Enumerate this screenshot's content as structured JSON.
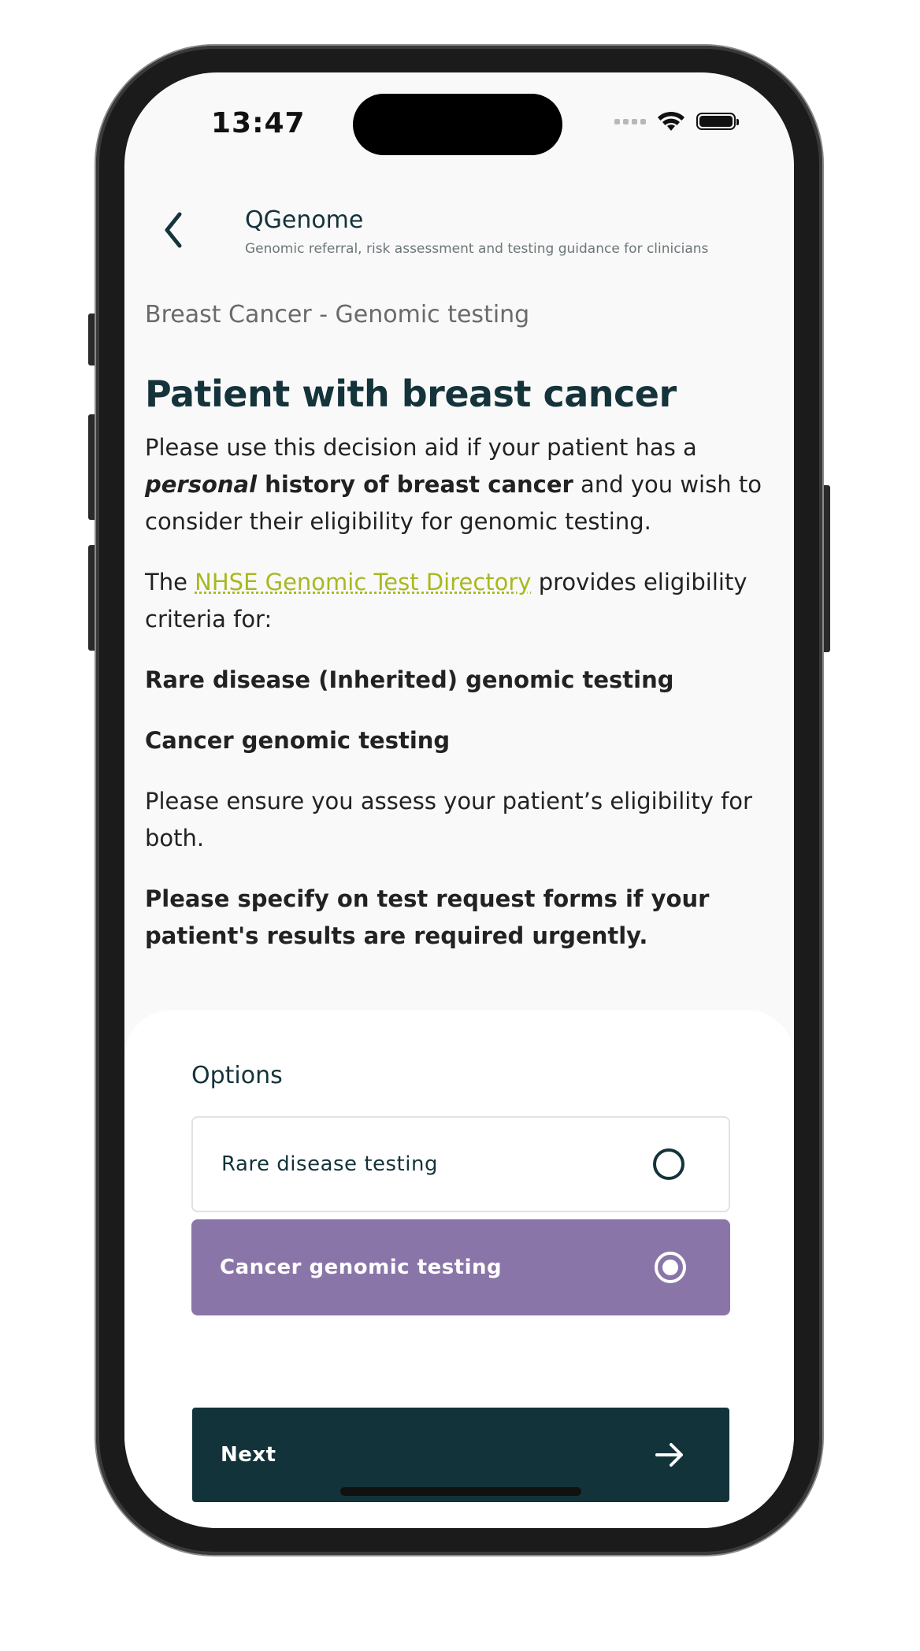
{
  "status_bar": {
    "time": "13:47"
  },
  "header": {
    "title": "QGenome",
    "subtitle": "Genomic referral, risk assessment and testing guidance for clinicians"
  },
  "content": {
    "breadcrumb": "Breast Cancer - Genomic testing",
    "title": "Patient with breast cancer",
    "intro": {
      "p1": "Please use this decision aid if your patient has a ",
      "p2_em": "personal",
      "p3_strong": " history of breast cancer",
      "p4": " and you wish to consider their eligibility for genomic testing."
    },
    "directory": {
      "prefix": "The ",
      "link": "NHSE Genomic Test Directory",
      "suffix": " provides eligibility criteria for:"
    },
    "criteria_1": "Rare disease (Inherited) genomic testing",
    "criteria_2": "Cancer genomic testing",
    "ensure": "Please ensure you assess your patient’s eligibility for both.",
    "urgent": "Please specify on test request forms if your patient's results are required urgently."
  },
  "options": {
    "label": "Options",
    "items": [
      {
        "label": "Rare disease testing",
        "selected": false
      },
      {
        "label": "Cancer genomic testing",
        "selected": true
      }
    ],
    "selected_color": "#8a75a8"
  },
  "actions": {
    "next_label": "Next"
  },
  "colors": {
    "primary": "#13333a",
    "link": "#a9b820"
  }
}
